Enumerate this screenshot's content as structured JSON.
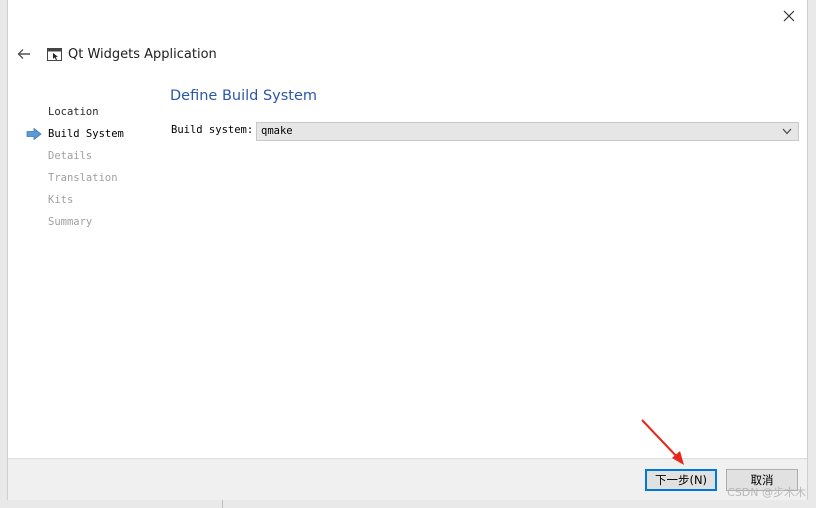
{
  "window": {
    "title": "Qt Widgets Application",
    "close_icon": "close-icon",
    "back_icon": "back-arrow-icon",
    "app_icon": "qt-widgets-app-icon"
  },
  "steps": [
    {
      "label": "Location",
      "state": "done"
    },
    {
      "label": "Build System",
      "state": "active"
    },
    {
      "label": "Details",
      "state": "pending"
    },
    {
      "label": "Translation",
      "state": "pending"
    },
    {
      "label": "Kits",
      "state": "pending"
    },
    {
      "label": "Summary",
      "state": "pending"
    }
  ],
  "page": {
    "title": "Define Build System",
    "build_system_label": "Build system:",
    "build_system_value": "qmake"
  },
  "footer": {
    "next_label": "下一步(N)",
    "cancel_label": "取消"
  },
  "watermark": "CSDN @步木木",
  "colors": {
    "accent": "#2a57a8",
    "focus_border": "#0078d7",
    "annotation_arrow": "#e8261c",
    "step_arrow": "#5b9bd5"
  }
}
